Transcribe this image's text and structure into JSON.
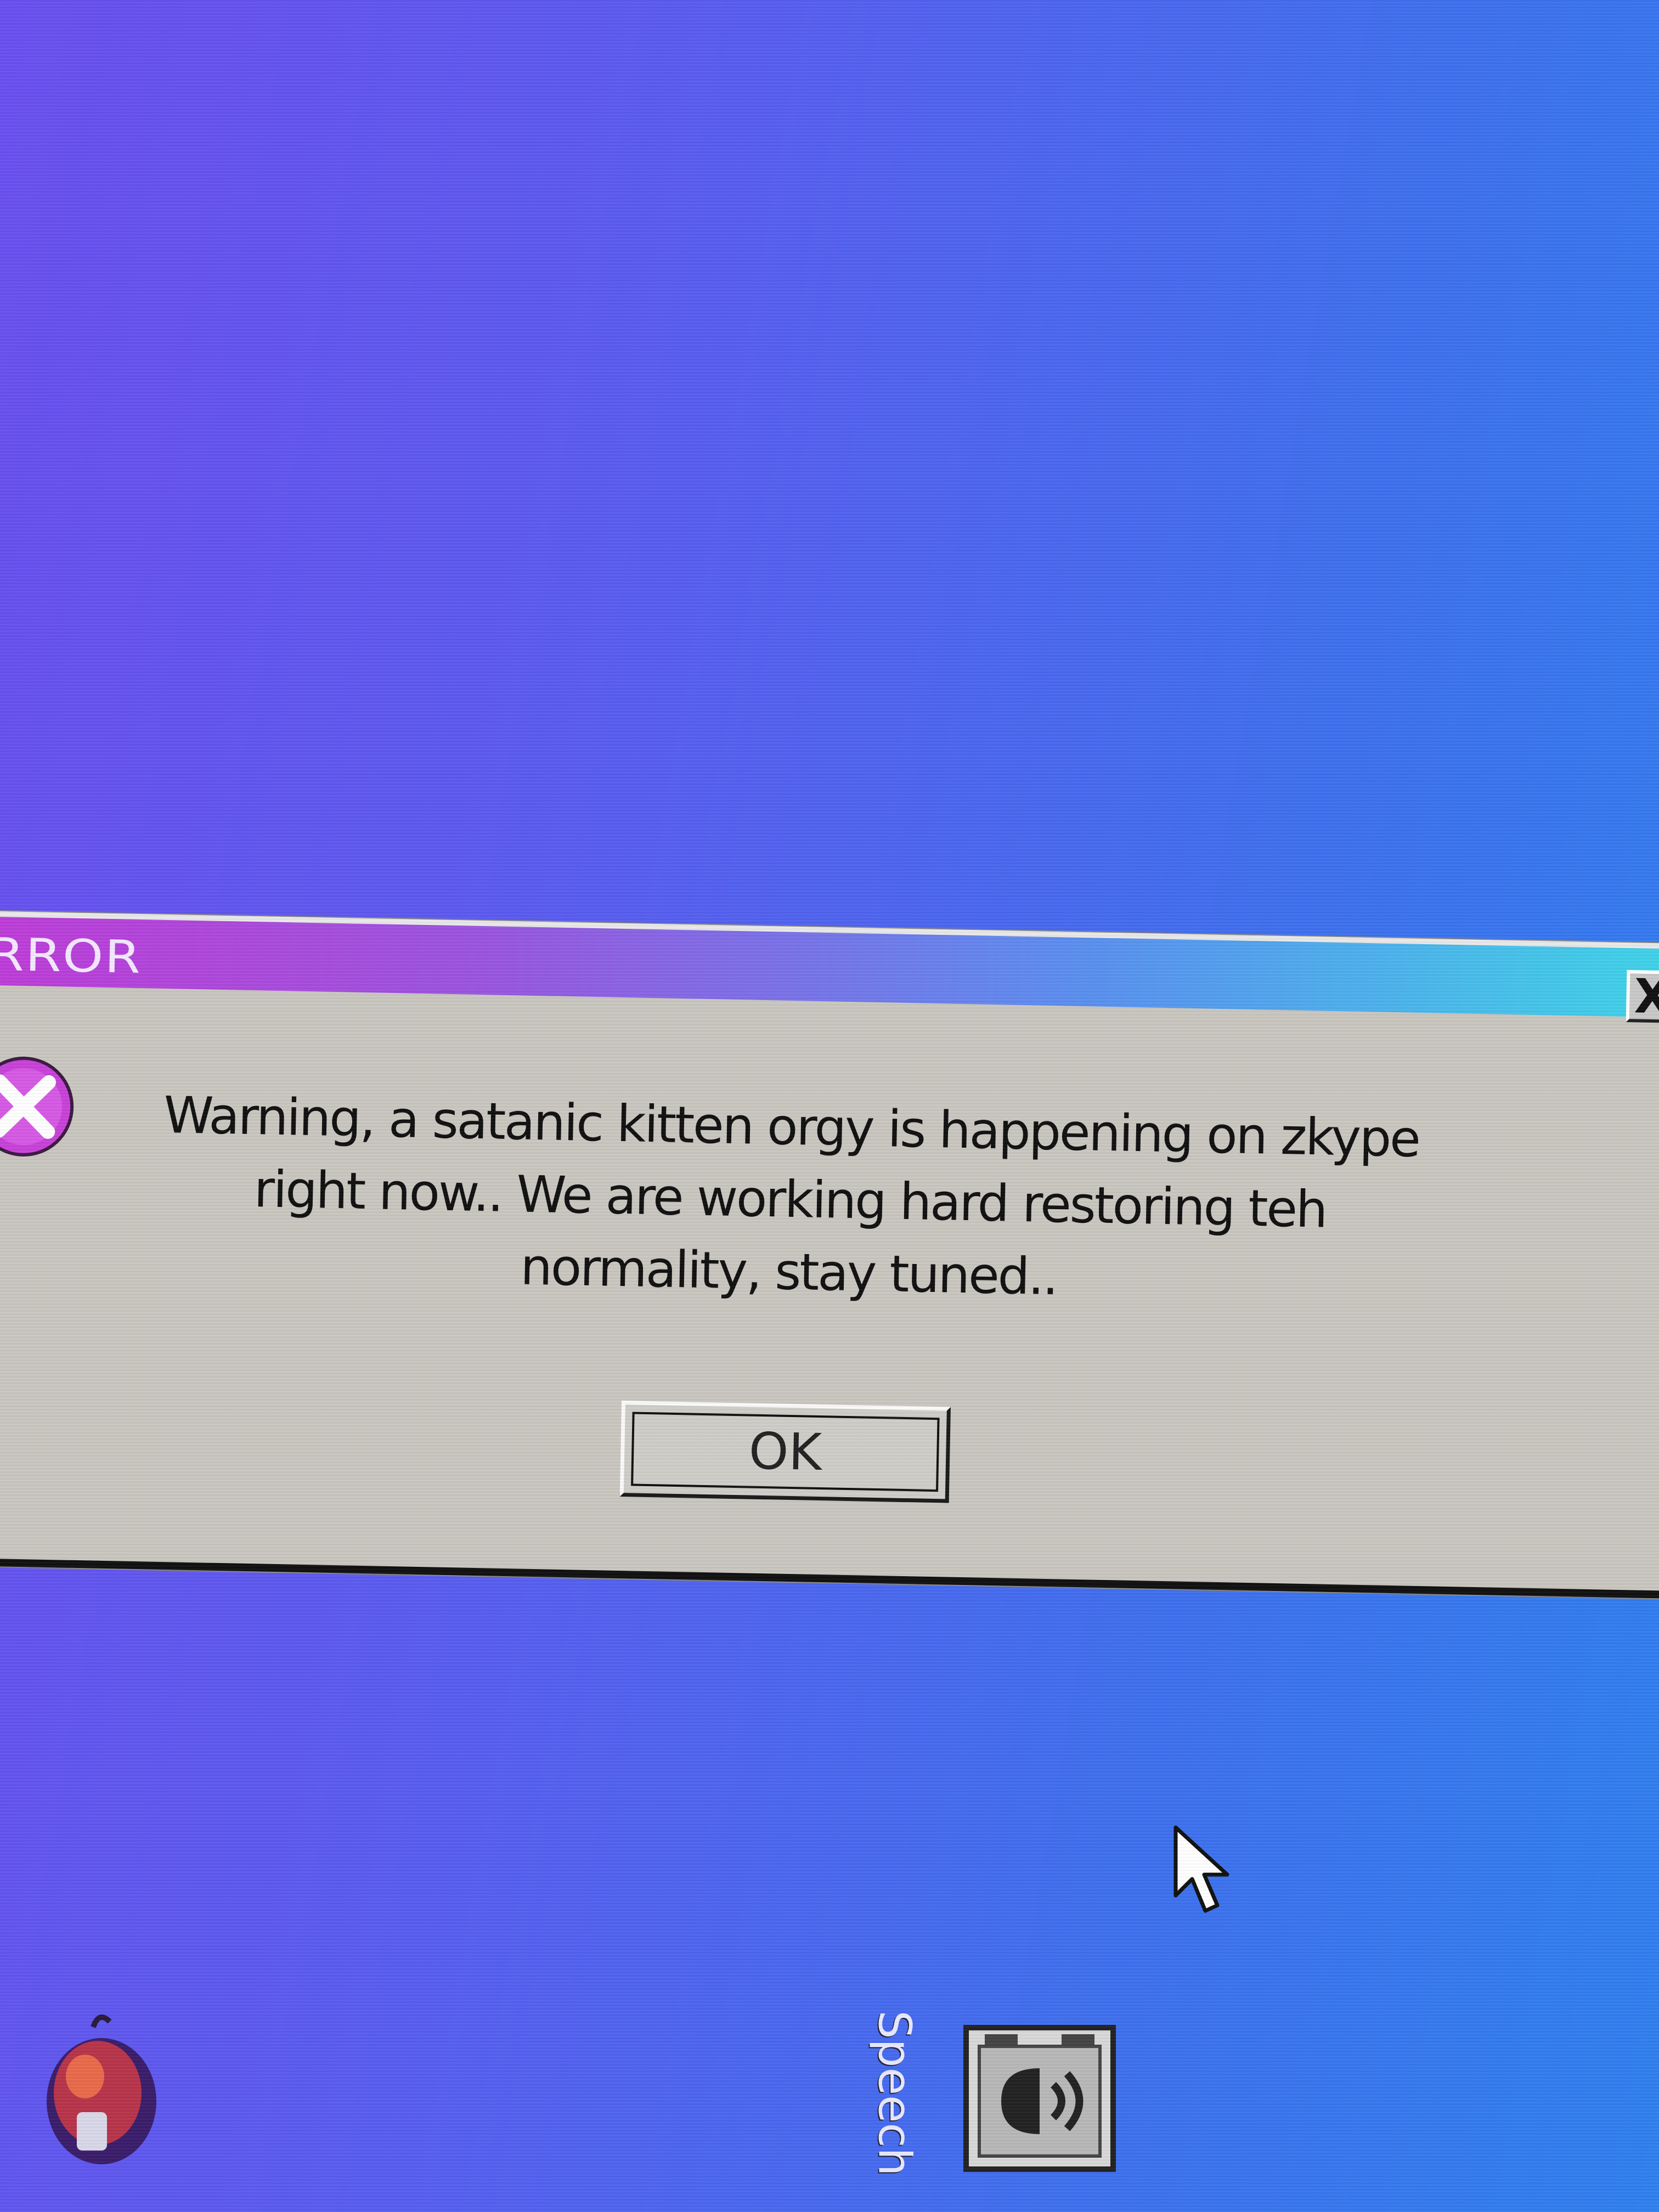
{
  "window": {
    "title": "RROR",
    "close_label": "X",
    "message_line1": "Warning, a satanic kitten orgy is happening on zkype",
    "message_line2": "right now.. We are working hard restoring teh",
    "message_line3": "normality, stay tuned..",
    "ok_label": "OK",
    "icon": "error-x-icon"
  },
  "desktop": {
    "speech_label": "Speech",
    "icons": [
      "app-icon",
      "speech-icon",
      "cursor-icon"
    ]
  },
  "colors": {
    "desktop_left": "#6a4ff0",
    "desktop_right": "#2f80f0",
    "titlebar_start": "#c03bd8",
    "titlebar_end": "#3ed6e8",
    "dialog_bg": "#c9c6c0",
    "error_icon": "#c842d8"
  }
}
